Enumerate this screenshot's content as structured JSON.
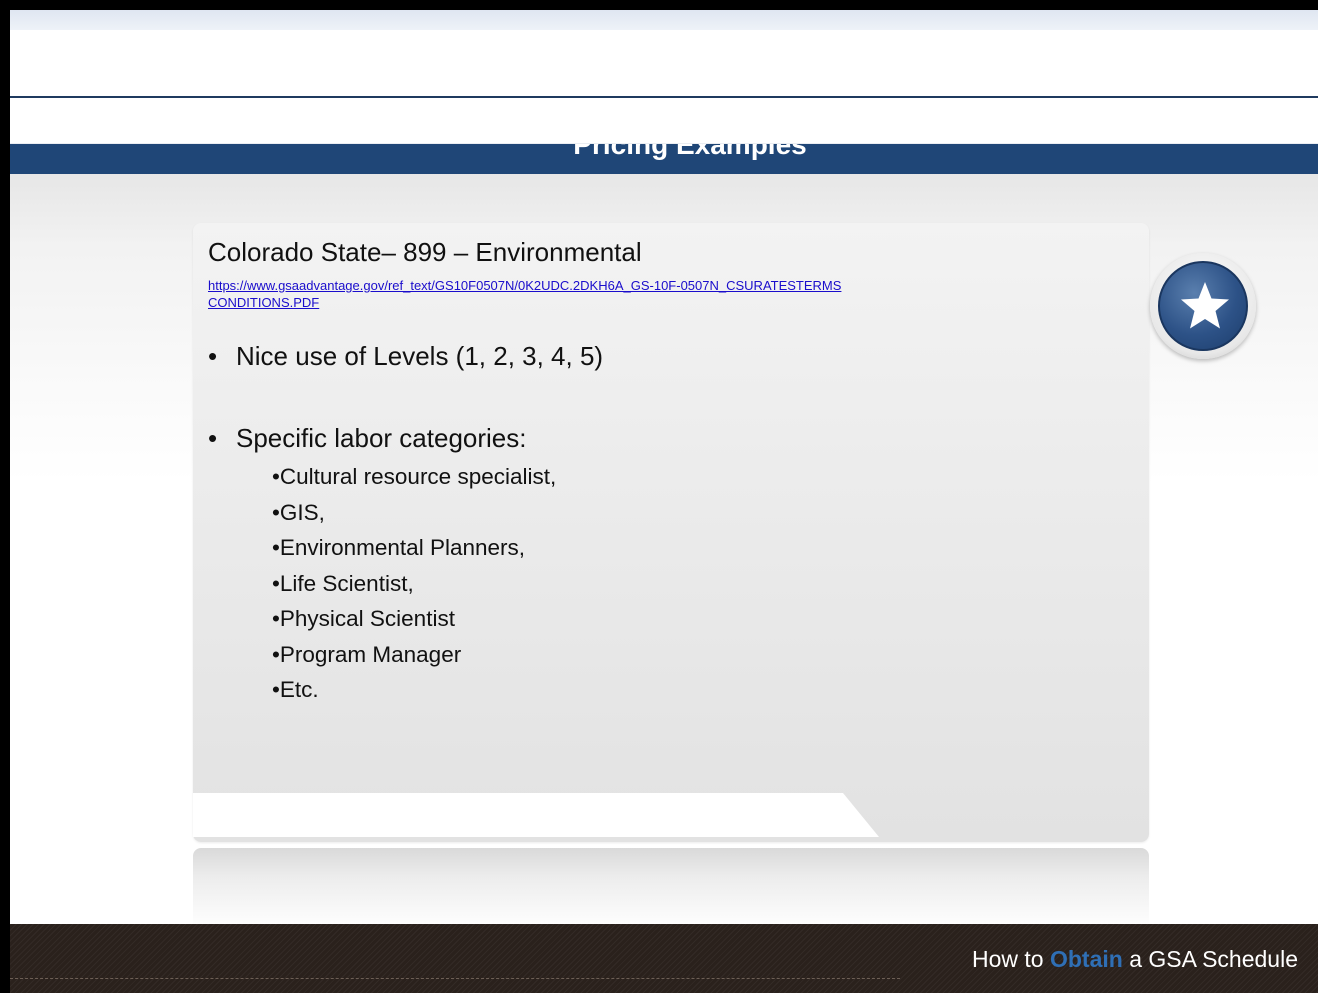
{
  "header": {
    "title": "Pricing Examples"
  },
  "content": {
    "heading": "Colorado State– 899 – Environmental",
    "link": "https://www.gsaadvantage.gov/ref_text/GS10F0507N/0K2UDC.2DKH6A_GS-10F-0507N_CSURATESTERMSCONDITIONS.PDF",
    "bullets": [
      "Nice use of Levels (1, 2, 3, 4, 5)",
      "Specific labor categories:"
    ],
    "bullet_glyph": "•",
    "sub_items": [
      "•Cultural resource specialist,",
      "•GIS,",
      "•Environmental Planners,",
      "•Life Scientist,",
      "•Physical Scientist",
      "•Program Manager",
      "•Etc."
    ]
  },
  "badge": {
    "icon": "star-icon"
  },
  "footer": {
    "prefix": "How to ",
    "accent": "Obtain",
    "suffix": " a GSA Schedule"
  },
  "colors": {
    "title_band": "#1f4677",
    "accent": "#2f6fb5",
    "footer_bg": "#2a211c",
    "link": "#1a0dcc"
  }
}
